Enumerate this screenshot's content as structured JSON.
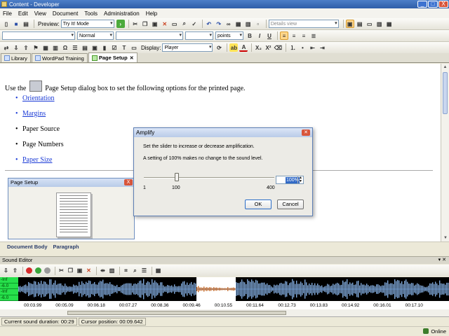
{
  "window": {
    "title": "Content - Developer",
    "min": "_",
    "max": "□",
    "close": "X"
  },
  "menu": [
    "File",
    "Edit",
    "View",
    "Document",
    "Tools",
    "Administration",
    "Help"
  ],
  "toolbar1": {
    "preview_label": "Preview:",
    "mode_value": "Try It! Mode",
    "view_value": "Details view"
  },
  "toolbar2": {
    "style_value": "",
    "para_value": "Normal",
    "font_value": "",
    "size_value": "",
    "units_value": "points",
    "bold": "B",
    "italic": "I",
    "underline": "U"
  },
  "toolbar3": {
    "display_label": "Display:",
    "display_value": "Player",
    "font_a": "A",
    "sub": "X₂",
    "sup": "X²"
  },
  "tabs": [
    {
      "label": "Library"
    },
    {
      "label": "WordPad Training"
    },
    {
      "label": "Page Setup",
      "close": "✕"
    }
  ],
  "document": {
    "intro_before": "Use the",
    "intro_after": "Page Setup dialog box to set the following options for the printed page.",
    "items": [
      "Orientation",
      "Margins",
      "Paper Source",
      "Page Numbers",
      "Paper Size"
    ],
    "mini_title": "Page Setup",
    "mini_close": "X"
  },
  "statusstrip": {
    "body": "Document Body",
    "para": "Paragraph"
  },
  "sound_editor": {
    "title": "Sound Editor",
    "pin": "▾ ✕",
    "meter": [
      "-Inf",
      "-6.0",
      "-Inf",
      "-6.0"
    ],
    "times": [
      "00:03.99",
      "00:05.09",
      "00:06.18",
      "00:07.27",
      "00:08.36",
      "00:09.46",
      "00:10.55",
      "00:11.64",
      "00:12.73",
      "00:13.83",
      "00:14.92",
      "00:16.01",
      "00:17.10"
    ],
    "duration": "Current sound duration: 00:29",
    "cursor": "Cursor position: 00:09.642"
  },
  "app_status": {
    "online": "Online"
  },
  "dialog": {
    "title": "Amplify",
    "close": "✕",
    "line1": "Set the slider to increase or decrease amplification.",
    "line2": "A setting of 100% makes no change to the sound level.",
    "min": "1",
    "mid": "100",
    "max": "400",
    "value": "100%",
    "ok": "OK",
    "cancel": "Cancel",
    "slider_level": 100
  }
}
